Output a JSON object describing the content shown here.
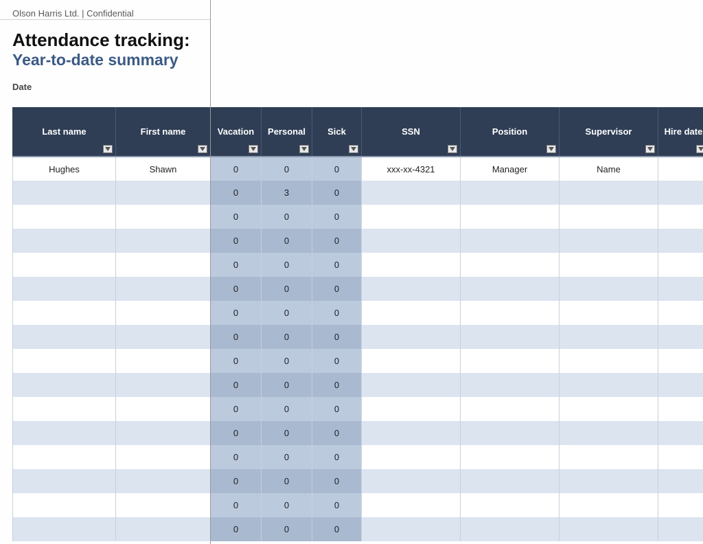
{
  "header": {
    "org_line": "Olson Harris Ltd. | Confidential",
    "title_line1": "Attendance tracking:",
    "title_line2": "Year-to-date summary",
    "date_label": "Date"
  },
  "columns": [
    "Last name",
    "First name",
    "Vacation",
    "Personal",
    "Sick",
    "SSN",
    "Position",
    "Supervisor",
    "Hire date"
  ],
  "rows": [
    {
      "last_name": "Hughes",
      "first_name": "Shawn",
      "vacation": "0",
      "personal": "0",
      "sick": "0",
      "ssn": "xxx-xx-4321",
      "position": "Manager",
      "supervisor": "Name",
      "hire_date": ""
    },
    {
      "last_name": "",
      "first_name": "",
      "vacation": "0",
      "personal": "3",
      "sick": "0",
      "ssn": "",
      "position": "",
      "supervisor": "",
      "hire_date": ""
    },
    {
      "last_name": "",
      "first_name": "",
      "vacation": "0",
      "personal": "0",
      "sick": "0",
      "ssn": "",
      "position": "",
      "supervisor": "",
      "hire_date": ""
    },
    {
      "last_name": "",
      "first_name": "",
      "vacation": "0",
      "personal": "0",
      "sick": "0",
      "ssn": "",
      "position": "",
      "supervisor": "",
      "hire_date": ""
    },
    {
      "last_name": "",
      "first_name": "",
      "vacation": "0",
      "personal": "0",
      "sick": "0",
      "ssn": "",
      "position": "",
      "supervisor": "",
      "hire_date": ""
    },
    {
      "last_name": "",
      "first_name": "",
      "vacation": "0",
      "personal": "0",
      "sick": "0",
      "ssn": "",
      "position": "",
      "supervisor": "",
      "hire_date": ""
    },
    {
      "last_name": "",
      "first_name": "",
      "vacation": "0",
      "personal": "0",
      "sick": "0",
      "ssn": "",
      "position": "",
      "supervisor": "",
      "hire_date": ""
    },
    {
      "last_name": "",
      "first_name": "",
      "vacation": "0",
      "personal": "0",
      "sick": "0",
      "ssn": "",
      "position": "",
      "supervisor": "",
      "hire_date": ""
    },
    {
      "last_name": "",
      "first_name": "",
      "vacation": "0",
      "personal": "0",
      "sick": "0",
      "ssn": "",
      "position": "",
      "supervisor": "",
      "hire_date": ""
    },
    {
      "last_name": "",
      "first_name": "",
      "vacation": "0",
      "personal": "0",
      "sick": "0",
      "ssn": "",
      "position": "",
      "supervisor": "",
      "hire_date": ""
    },
    {
      "last_name": "",
      "first_name": "",
      "vacation": "0",
      "personal": "0",
      "sick": "0",
      "ssn": "",
      "position": "",
      "supervisor": "",
      "hire_date": ""
    },
    {
      "last_name": "",
      "first_name": "",
      "vacation": "0",
      "personal": "0",
      "sick": "0",
      "ssn": "",
      "position": "",
      "supervisor": "",
      "hire_date": ""
    },
    {
      "last_name": "",
      "first_name": "",
      "vacation": "0",
      "personal": "0",
      "sick": "0",
      "ssn": "",
      "position": "",
      "supervisor": "",
      "hire_date": ""
    },
    {
      "last_name": "",
      "first_name": "",
      "vacation": "0",
      "personal": "0",
      "sick": "0",
      "ssn": "",
      "position": "",
      "supervisor": "",
      "hire_date": ""
    },
    {
      "last_name": "",
      "first_name": "",
      "vacation": "0",
      "personal": "0",
      "sick": "0",
      "ssn": "",
      "position": "",
      "supervisor": "",
      "hire_date": ""
    },
    {
      "last_name": "",
      "first_name": "",
      "vacation": "0",
      "personal": "0",
      "sick": "0",
      "ssn": "",
      "position": "",
      "supervisor": "",
      "hire_date": ""
    }
  ]
}
